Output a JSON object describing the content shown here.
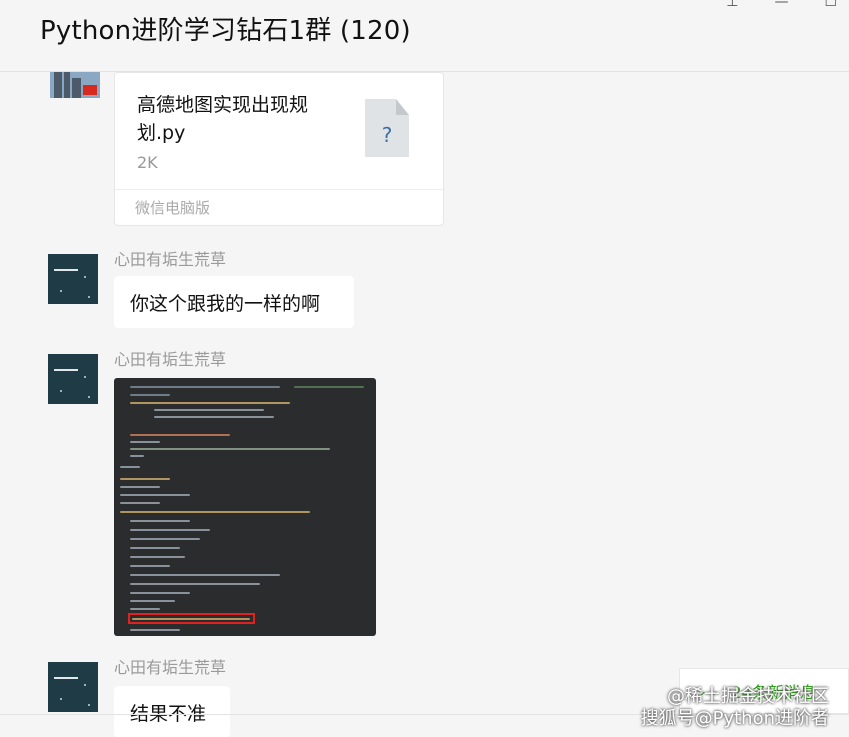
{
  "header": {
    "title": "Python进阶学习钻石1群 (120)"
  },
  "messages": [
    {
      "type": "file",
      "file": {
        "name": "高德地图实现出现规划.py",
        "size": "2K",
        "source": "微信电脑版"
      }
    },
    {
      "type": "text",
      "sender": "心田有垢生荒草",
      "text": "你这个跟我的一样的啊"
    },
    {
      "type": "image",
      "sender": "心田有垢生荒草"
    },
    {
      "type": "text",
      "sender": "心田有垢生荒草",
      "text": "结果不准"
    }
  ],
  "new_messages": {
    "label": "24条新消息"
  },
  "watermark": {
    "line1": "@稀土掘金技术社区",
    "line2": "搜狐号@Python进阶者"
  },
  "colors": {
    "background": "#f5f5f5",
    "bubble": "#ffffff",
    "accent_green": "#2aa515",
    "highlight_red": "#e0231f"
  },
  "icons": [
    "pin-icon",
    "minimize-icon",
    "maximize-icon",
    "file-unknown-icon",
    "chevron-down-icon"
  ]
}
